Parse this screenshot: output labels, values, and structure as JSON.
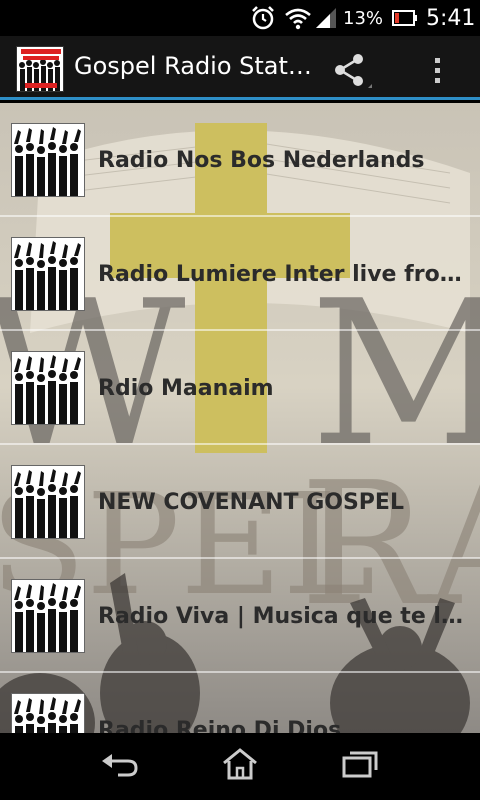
{
  "status_bar": {
    "battery_percent": "13%",
    "time": "5:41",
    "icons": [
      "alarm-icon",
      "wifi-icon",
      "signal-icon",
      "battery-icon"
    ]
  },
  "action_bar": {
    "title": "Gospel Radio Stat…",
    "app_icon_text": "Gospel Radio Stations",
    "icons": [
      "share-icon",
      "overflow-menu-icon"
    ],
    "accent_color": "#2e8fc7"
  },
  "stations": [
    {
      "label": "Radio Nos Bos Nederlands"
    },
    {
      "label": "Radio Lumiere Inter live from…"
    },
    {
      "label": "Rdio Maanaim"
    },
    {
      "label": "NEW COVENANT GOSPEL"
    },
    {
      "label": "Radio Viva | Musica que te ll…"
    },
    {
      "label": "Radio Reino Di Dios"
    }
  ],
  "background_text": "WTM GOSPEL RA",
  "nav_bar": {
    "icons": [
      "back-icon",
      "home-icon",
      "recent-apps-icon"
    ]
  }
}
